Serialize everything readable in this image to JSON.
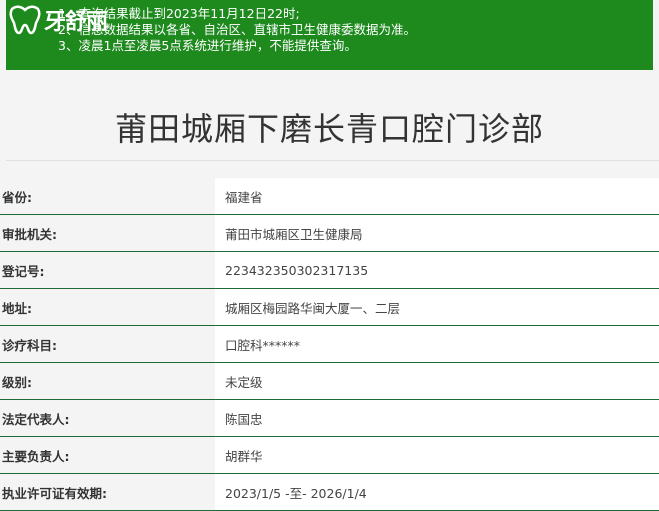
{
  "notice": {
    "lines": [
      "1、查询结果截止到2023年11月12日22时;",
      "2、信息数据结果以各省、自治区、直辖市卫生健康委数据为准。",
      "3、凌晨1点至凌晨5点系统进行维护，不能提供查询。"
    ],
    "background": "#1e8a1e"
  },
  "logo": {
    "text": "牙舒丽",
    "icon": "tooth-icon"
  },
  "page": {
    "title": "莆田城厢下磨长青口腔门诊部"
  },
  "info": {
    "rows": [
      {
        "label": "省份:",
        "value": "福建省"
      },
      {
        "label": "审批机关:",
        "value": "莆田市城厢区卫生健康局"
      },
      {
        "label": "登记号:",
        "value": "223432350302317135"
      },
      {
        "label": "地址:",
        "value": "城厢区梅园路华闽大厦一、二层"
      },
      {
        "label": "诊疗科目:",
        "value": "口腔科******"
      },
      {
        "label": "级别:",
        "value": "未定级"
      },
      {
        "label": "法定代表人:",
        "value": "陈国忠"
      },
      {
        "label": "主要负责人:",
        "value": "胡群华"
      },
      {
        "label": "执业许可证有效期:",
        "value": "2023/1/5 -至- 2026/1/4"
      }
    ],
    "row_border_color": "#1e6b3a"
  }
}
